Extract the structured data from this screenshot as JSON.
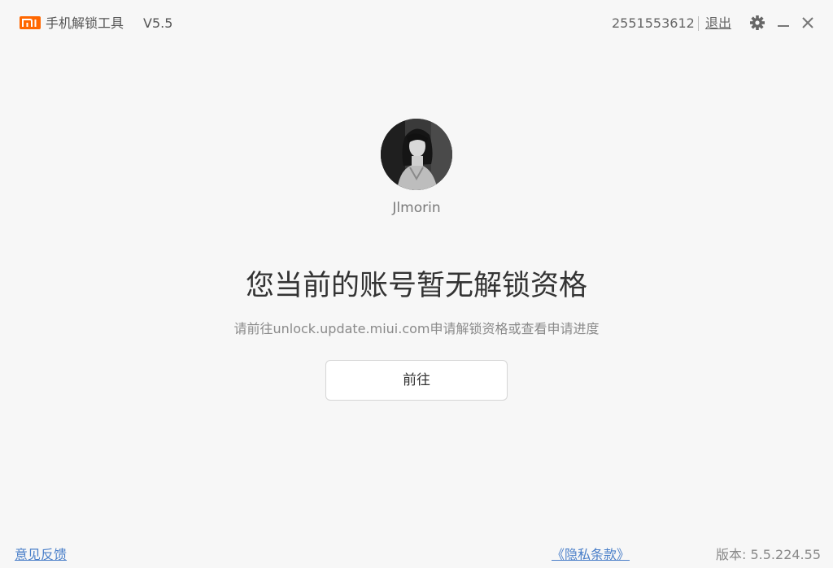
{
  "titlebar": {
    "logo_text": "MI",
    "app_name": "手机解锁工具",
    "version": "V5.5",
    "account_id": "2551553612",
    "logout_label": "退出"
  },
  "icons": {
    "logo": "mi-logo",
    "settings": "gear-icon",
    "minimize": "minimize-icon",
    "close": "close-icon"
  },
  "profile": {
    "username": "Jlmorin"
  },
  "main": {
    "headline": "您当前的账号暂无解锁资格",
    "subline": "请前往unlock.update.miui.com申请解锁资格或查看申请进度",
    "go_button_label": "前往"
  },
  "footer": {
    "feedback_label": "意见反馈",
    "privacy_label": "《隐私条款》",
    "version_label": "版本: 5.5.224.55"
  },
  "colors": {
    "brand": "#ff6700",
    "link": "#4a7fc9",
    "background": "#f7f7f7"
  }
}
